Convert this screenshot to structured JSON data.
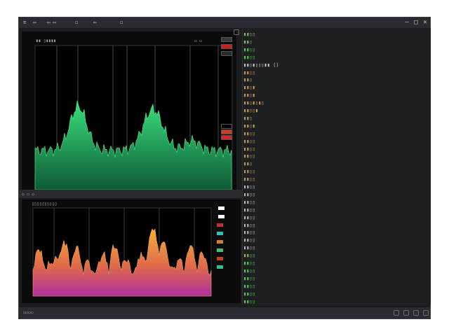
{
  "titlebar": {
    "items": [
      "≡",
      "▭",
      "▭ ▭",
      "◻",
      "▭",
      "◻"
    ],
    "close": "✕",
    "maximize": "□",
    "minimize": "–"
  },
  "top_panel": {
    "header_a": "▮▮ ▯▮▮▮▮",
    "header_b": "▭ ▭",
    "y_ticks": [
      "",
      "",
      "",
      "",
      "",
      "",
      "",
      ""
    ],
    "x_ticks": [
      "",
      "",
      "",
      "",
      "",
      "",
      "",
      "",
      ""
    ]
  },
  "bottom_panel": {
    "header": "▯▯▯▯▯▯▯▯▯▯",
    "toolbar": "▭ ▭ ▭",
    "x_ticks": [
      "",
      "",
      "",
      "",
      "",
      "",
      "",
      "",
      ""
    ]
  },
  "status": {
    "left": "▭▭▭▭",
    "right": "▭▭▭"
  },
  "code_lines": [
    {
      "t": "▮▮▯▯",
      "c": "#8fbf6f"
    },
    {
      "t": "▮▮▯",
      "c": "#8fbf6f"
    },
    {
      "t": "▮▮▯▯",
      "c": "#55d05a"
    },
    {
      "t": "▮▮▯▯",
      "c": "#55d05a"
    },
    {
      "t": "▮▮▯▮▯▯▯▮▮   ()",
      "c": "#c8c8c8"
    },
    {
      "t": "▮▮▯▯",
      "c": "#c8a060"
    },
    {
      "t": "▮▮▯",
      "c": "#c8a060"
    },
    {
      "t": "▮▮▯▮",
      "c": "#c8a060"
    },
    {
      "t": "▮▮▯▮",
      "c": "#c8a060"
    },
    {
      "t": "▮▮▯▮▯▮▯",
      "c": "#c8a060"
    },
    {
      "t": "▮▮▯▯▮",
      "c": "#c8a060"
    },
    {
      "t": "▮▮▯",
      "c": "#c8a060"
    },
    {
      "t": "▮▮▯▮",
      "c": "#c8a060"
    },
    {
      "t": "▮▮▯▯",
      "c": "#c8a060"
    },
    {
      "t": "▮▮▯▯",
      "c": "#c8a060"
    },
    {
      "t": "▮▮▯▯",
      "c": "#c8a060"
    },
    {
      "t": "▮▮▯▯",
      "c": "#c8a060"
    },
    {
      "t": "▮▮▯",
      "c": "#c8a060"
    },
    {
      "t": "▮▮▯▯",
      "c": "#c8a060"
    },
    {
      "t": "▮▮▯▯",
      "c": "#c8a060"
    },
    {
      "t": "▮▮▯▯",
      "c": "#b8bcc2"
    },
    {
      "t": "▮▮▯▯",
      "c": "#b8bcc2"
    },
    {
      "t": "▮▮▯▯",
      "c": "#b8bcc2"
    },
    {
      "t": "▮▮▯▯",
      "c": "#b8bcc2"
    },
    {
      "t": "▮▮▯▯",
      "c": "#b8bcc2"
    },
    {
      "t": "▮▮▯▯",
      "c": "#b8bcc2"
    },
    {
      "t": "▮▮▯▯",
      "c": "#b8bcc2"
    },
    {
      "t": "▮▮▯▯",
      "c": "#b8bcc2"
    },
    {
      "t": "▮▮▯▯",
      "c": "#b8bcc2"
    },
    {
      "t": "▮▮▯▯",
      "c": "#8fbf6f"
    },
    {
      "t": "▮▮▯▯",
      "c": "#55d05a"
    },
    {
      "t": "▮▮▯▯",
      "c": "#55d05a"
    },
    {
      "t": "▮▮▯▯",
      "c": "#55d05a"
    },
    {
      "t": "▮▮▯▯",
      "c": "#55d05a"
    },
    {
      "t": "▮▮▯▯",
      "c": "#55d05a"
    },
    {
      "t": "▮▮▯▯",
      "c": "#55d05a"
    }
  ],
  "top_swatches": [
    "#3a3a3a",
    "#c82020",
    "#2a2a2a",
    "#000000",
    "#c84020",
    "#d02828"
  ],
  "bottom_swatches": [
    "#ffffff",
    "#ffffff",
    "#c03030",
    "#30c0b0",
    "#d08020",
    "#40c080",
    "#c04020",
    "#30c090"
  ],
  "colors": {
    "green_fill": "#34d27a",
    "spectrum_top": "#f2a23a",
    "spectrum_bottom": "#b23aa8"
  }
}
